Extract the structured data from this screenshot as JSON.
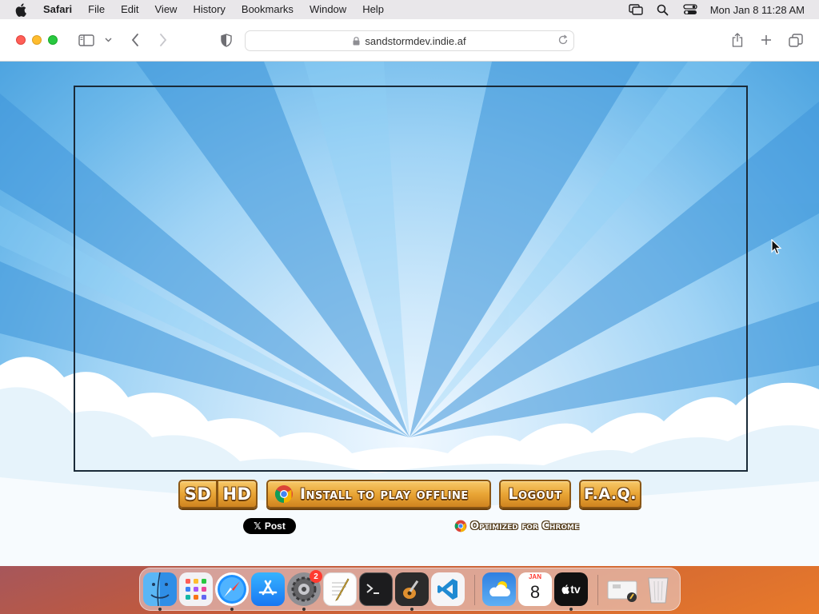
{
  "menubar": {
    "app_name": "Safari",
    "items": [
      "File",
      "Edit",
      "View",
      "History",
      "Bookmarks",
      "Window",
      "Help"
    ],
    "clock": "Mon Jan 8  11:28 AM"
  },
  "browser": {
    "url": "sandstormdev.indie.af"
  },
  "game": {
    "sd_label": "SD",
    "hd_label": "HD",
    "install_label": "Install to play offline",
    "logout_label": "Logout",
    "faq_label": "F.A.Q.",
    "post_label": "Post",
    "optimized_label": "Optimized for Chrome"
  },
  "dock": {
    "calendar_month": "JAN",
    "calendar_day": "8",
    "settings_badge": "2",
    "tv_label": "tv",
    "apps": [
      "Finder",
      "Launchpad",
      "Safari",
      "App Store",
      "System Settings",
      "TextEdit",
      "Terminal",
      "GarageBand",
      "Visual Studio Code",
      "Weather",
      "Calendar",
      "Apple TV",
      "Preview",
      "Trash"
    ]
  },
  "colors": {
    "sky_light": "#f0f8ff",
    "sky_dark": "#4ea4e0",
    "wood": "#e9a535",
    "wood_dark": "#8a5614"
  }
}
